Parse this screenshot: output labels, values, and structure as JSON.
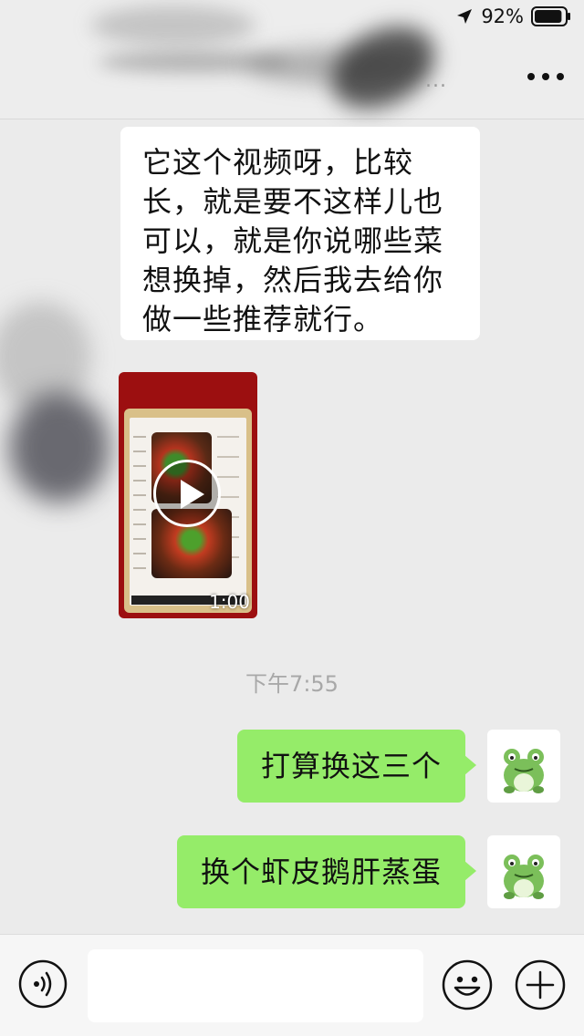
{
  "status_bar": {
    "battery_percent_text": "92%",
    "battery_level": 0.92,
    "icons": [
      "location-arrow-icon",
      "battery-icon"
    ]
  },
  "header": {
    "sub_text": "...",
    "more_icon": "more-dots-icon"
  },
  "messages": {
    "incoming_text": "它这个视频呀，比较长，就是要不这样儿也可以，就是你说哪些菜想换掉，然后我去给你做一些推荐就行。",
    "video": {
      "duration": "1:00",
      "icon": "play-icon"
    },
    "timestamp": "下午7:55",
    "outgoing": [
      {
        "text": "打算换这三个"
      },
      {
        "text": "换个虾皮鹅肝蒸蛋"
      }
    ]
  },
  "input_bar": {
    "value": "",
    "icons": [
      "voice-icon",
      "emoji-icon",
      "add-icon"
    ]
  },
  "colors": {
    "background": "#ebebeb",
    "outgoing_bubble": "#95ec69",
    "incoming_bubble": "#ffffff",
    "timestamp": "#a8a8a8",
    "frog_avatar": "#7bbf5a"
  }
}
